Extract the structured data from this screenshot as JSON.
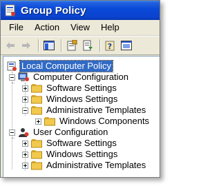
{
  "window": {
    "title": "Group Policy",
    "colors": {
      "titlebar": "#0a4ad8",
      "chrome": "#ece9d8",
      "selection": "#316ac5",
      "folder": "#f2c94c"
    }
  },
  "menu": {
    "items": [
      {
        "label": "File"
      },
      {
        "label": "Action"
      },
      {
        "label": "View"
      },
      {
        "label": "Help"
      }
    ]
  },
  "toolbar": {
    "buttons": [
      {
        "icon": "back-arrow-icon"
      },
      {
        "icon": "forward-arrow-icon"
      },
      {
        "icon": "show-hide-tree-icon"
      },
      {
        "icon": "properties-icon"
      },
      {
        "icon": "export-list-icon"
      },
      {
        "icon": "help-icon"
      },
      {
        "icon": "console-window-icon"
      }
    ]
  },
  "tree": {
    "root": {
      "label": "Local Computer Policy",
      "icon": "policy-icon",
      "selected": true
    },
    "computer_configuration": {
      "label": "Computer Configuration",
      "icon": "computer-icon",
      "children": [
        {
          "label": "Software Settings",
          "icon": "folder-icon"
        },
        {
          "label": "Windows Settings",
          "icon": "folder-icon"
        },
        {
          "label": "Administrative Templates",
          "icon": "folder-icon"
        },
        {
          "label": "Windows Components",
          "icon": "folder-icon"
        }
      ]
    },
    "user_configuration": {
      "label": "User Configuration",
      "icon": "user-icon",
      "children": [
        {
          "label": "Software Settings",
          "icon": "folder-icon"
        },
        {
          "label": "Windows Settings",
          "icon": "folder-icon"
        },
        {
          "label": "Administrative Templates",
          "icon": "folder-icon"
        }
      ]
    }
  }
}
